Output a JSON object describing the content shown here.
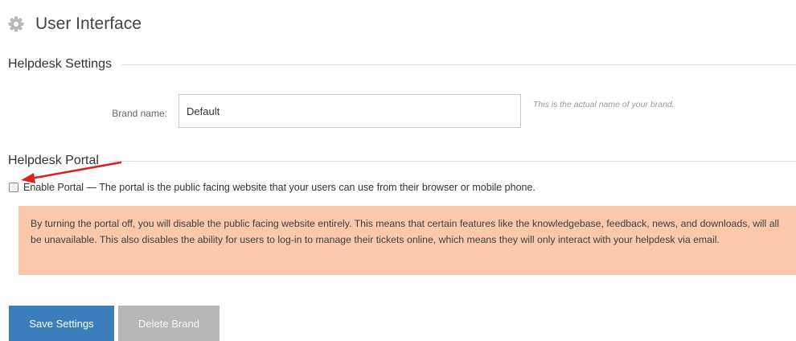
{
  "header": {
    "title": "User Interface",
    "icon": "gear-icon"
  },
  "helpdesk_settings": {
    "title": "Helpdesk Settings",
    "brand_name": {
      "label": "Brand name:",
      "value": "Default",
      "help": "This is the actual name of your brand."
    }
  },
  "helpdesk_portal": {
    "title": "Helpdesk Portal",
    "enable_checkbox": {
      "checked": false,
      "label": "Enable Portal — The portal is the public facing website that your users can use from their browser or mobile phone."
    },
    "warning": "By turning the portal off, you will disable the public facing website entirely. This means that certain features like the knowledgebase, feedback, news, and downloads, will all be unavailable. This also disables the ability for users to log-in to manage their tickets online, which means they will only interact with your helpdesk via email."
  },
  "buttons": {
    "save": "Save Settings",
    "delete": "Delete Brand"
  },
  "colors": {
    "primary": "#3a7fbb",
    "disabled": "#b7b7b7",
    "warning_bg": "#fbc8a9",
    "annotation_arrow": "#e02020"
  }
}
